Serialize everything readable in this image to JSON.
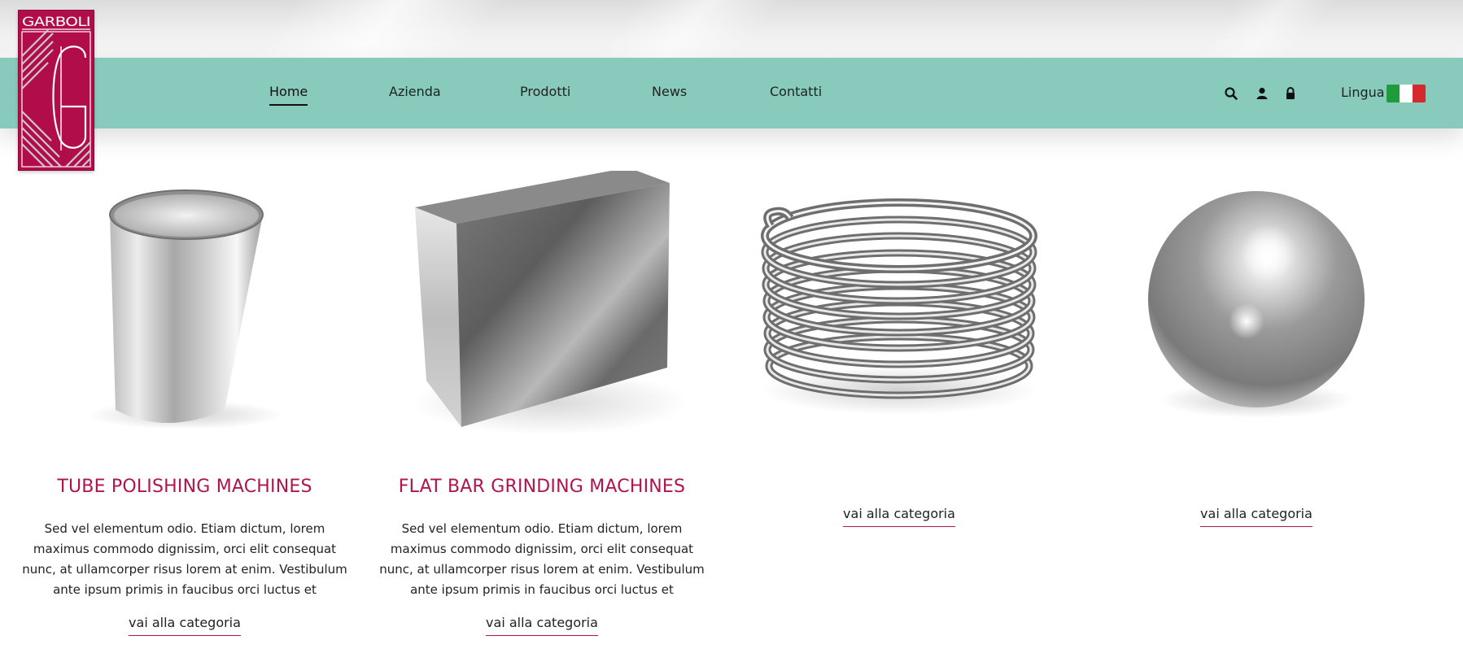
{
  "brand": {
    "logo_text": "GARBOLI",
    "colors": {
      "primary": "#b20d4b",
      "accent_bar": "#88cbbd",
      "title": "#b0144e"
    }
  },
  "nav": {
    "items": [
      {
        "label": "Home",
        "active": true
      },
      {
        "label": "Azienda",
        "active": false
      },
      {
        "label": "Prodotti",
        "active": false
      },
      {
        "label": "News",
        "active": false
      },
      {
        "label": "Contatti",
        "active": false
      }
    ],
    "icons": [
      "search-icon",
      "user-icon",
      "lock-icon"
    ],
    "language_label": "Lingua",
    "language_flag": "italy-flag-icon"
  },
  "products": [
    {
      "image": "cylinder-tube",
      "title": "TUBE POLISHING MACHINES",
      "description": "Sed vel elementum odio. Etiam dictum, lorem maximus commodo dignissim, orci elit consequat nunc, at ullamcorper risus lorem at enim. Vestibulum ante ipsum primis in faucibus orci luctus et",
      "link_label": "vai alla categoria"
    },
    {
      "image": "flat-bar",
      "title": "FLAT BAR GRINDING MACHINES",
      "description": "Sed vel elementum odio. Etiam dictum, lorem maximus commodo dignissim, orci elit consequat nunc, at ullamcorper risus lorem at enim. Vestibulum ante ipsum primis in faucibus orci luctus et",
      "link_label": "vai alla categoria"
    },
    {
      "image": "coil-spring",
      "title": "",
      "description": "",
      "link_label": "vai alla categoria"
    },
    {
      "image": "steel-sphere",
      "title": "",
      "description": "",
      "link_label": "vai alla categoria"
    }
  ]
}
